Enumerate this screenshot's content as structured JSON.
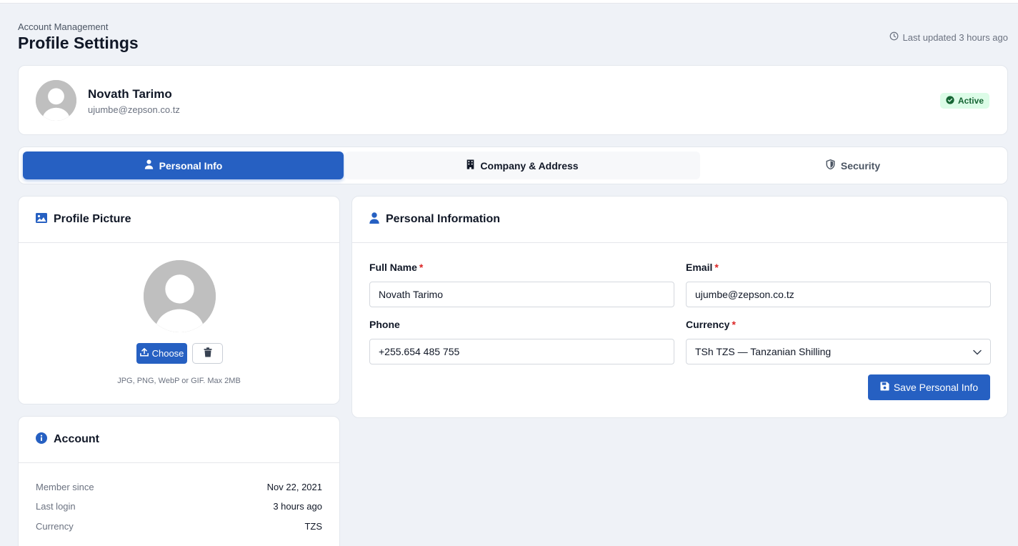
{
  "header": {
    "breadcrumb": "Account Management",
    "title": "Profile Settings",
    "last_updated": "Last updated 3 hours ago"
  },
  "profile": {
    "name": "Novath Tarimo",
    "email": "ujumbe@zepson.co.tz",
    "status": "Active"
  },
  "tabs": [
    {
      "label": "Personal Info",
      "icon": "user-icon",
      "active": true
    },
    {
      "label": "Company & Address",
      "icon": "building-icon",
      "active": false
    },
    {
      "label": "Security",
      "icon": "shield-icon",
      "active": false
    }
  ],
  "picture": {
    "title": "Profile Picture",
    "choose_label": "Choose",
    "hint": "JPG, PNG, WebP or GIF. Max 2MB"
  },
  "account": {
    "title": "Account",
    "rows": [
      {
        "label": "Member since",
        "value": "Nov 22, 2021"
      },
      {
        "label": "Last login",
        "value": "3 hours ago"
      },
      {
        "label": "Currency",
        "value": "TZS"
      }
    ]
  },
  "personal": {
    "title": "Personal Information",
    "full_name_label": "Full Name",
    "full_name_value": "Novath Tarimo",
    "email_label": "Email",
    "email_value": "ujumbe@zepson.co.tz",
    "phone_label": "Phone",
    "phone_value": "+255.654 485 755",
    "currency_label": "Currency",
    "currency_value": "TSh TZS — Tanzanian Shilling",
    "required_mark": "*",
    "save_label": "Save Personal Info"
  },
  "colors": {
    "primary": "#2660c2",
    "background": "#eff2f7",
    "success_bg": "#dcfce7",
    "success_text": "#166534",
    "required": "#dc2626"
  }
}
